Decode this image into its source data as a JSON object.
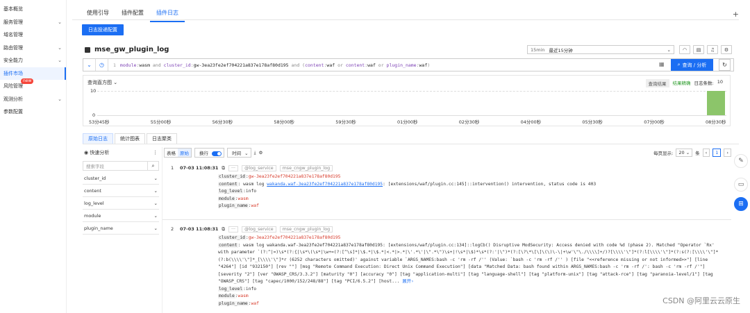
{
  "sidebar": {
    "items": [
      {
        "label": "基本概览",
        "chevron": false
      },
      {
        "label": "服务管理",
        "chevron": true
      },
      {
        "label": "域名管理",
        "chevron": false
      },
      {
        "label": "路由管理",
        "chevron": true
      },
      {
        "label": "安全能力",
        "chevron": true
      },
      {
        "label": "插件市场",
        "chevron": false,
        "active": true
      },
      {
        "label": "风险管理",
        "chevron": false,
        "badge": "new"
      },
      {
        "label": "观测分析",
        "chevron": true
      },
      {
        "label": "参数配置",
        "chevron": false
      }
    ]
  },
  "tabs": [
    {
      "label": "使用引导"
    },
    {
      "label": "插件配置"
    },
    {
      "label": "插件日志",
      "active": true
    }
  ],
  "primary_button": "日志投递配置",
  "logstore": {
    "title": "mse_gw_plugin_log"
  },
  "time": {
    "tag": "15min",
    "label": "最近15分钟"
  },
  "query": {
    "line": "1",
    "parts": [
      {
        "t": "module",
        "c": "k"
      },
      {
        "t": ":",
        "c": "op"
      },
      {
        "t": "wasm",
        "c": "v"
      },
      {
        "t": " and ",
        "c": "op"
      },
      {
        "t": "cluster_id",
        "c": "k"
      },
      {
        "t": ":",
        "c": "op"
      },
      {
        "t": "gw-3ea23fe2ef704221a837e178af80d195",
        "c": "v"
      },
      {
        "t": " and (",
        "c": "op"
      },
      {
        "t": "content",
        "c": "k"
      },
      {
        "t": ":",
        "c": "op"
      },
      {
        "t": "waf",
        "c": "v"
      },
      {
        "t": " or ",
        "c": "op"
      },
      {
        "t": "content",
        "c": "k"
      },
      {
        "t": ":",
        "c": "op"
      },
      {
        "t": "waf",
        "c": "v"
      },
      {
        "t": " or ",
        "c": "op"
      },
      {
        "t": "plugin_name",
        "c": "k"
      },
      {
        "t": ":",
        "c": "op"
      },
      {
        "t": "waf",
        "c": "v"
      },
      {
        "t": ")",
        "c": "op"
      }
    ],
    "button": "查询 / 分析"
  },
  "histogram": {
    "label": "查询直方图",
    "result_tag": "查询结果",
    "accuracy": "结果精确",
    "count_label": "日志条数:",
    "count": "10"
  },
  "chart_data": {
    "type": "bar",
    "title": "查询直方图",
    "categories": [
      "53分45秒",
      "55分00秒",
      "56分30秒",
      "58分00秒",
      "59分30秒",
      "01分00秒",
      "02分30秒",
      "04分00秒",
      "05分30秒",
      "07分00秒",
      "08分30秒"
    ],
    "values": [
      0,
      0,
      0,
      0,
      0,
      0,
      0,
      0,
      0,
      0,
      10
    ],
    "yticks": [
      "10",
      "0"
    ],
    "ylim": [
      0,
      10
    ],
    "bar_color": "#8cc56a"
  },
  "log_tabs": [
    {
      "label": "原始日志",
      "active": true
    },
    {
      "label": "统计图表"
    },
    {
      "label": "日志聚类"
    }
  ],
  "quick": {
    "title": "快速分析",
    "search_placeholder": "搜索字段",
    "fields": [
      "cluster_id",
      "content",
      "log_level",
      "module",
      "plugin_name"
    ]
  },
  "toolbar": {
    "table": "表格",
    "raw": "原始",
    "wrap": "换行",
    "time": "时间",
    "per_page_label": "每页显示:",
    "per_page": "20",
    "unit": "条",
    "page": "1"
  },
  "logs": [
    {
      "index": "1",
      "time": "07-03 11:08:31",
      "source": "@log_service",
      "store": "mse_cngw_plugin_log",
      "fields": {
        "cluster_id": "gw-3ea23fe2ef704221a837e178af80d195",
        "content_prefix": "wasm log ",
        "content_link": "wakanda.waf-3ea23fe2ef704221a837e178af80d195",
        "content_rest": ": [extensions/waf/plugin.cc:145]::intervention() intervention, status code is 403",
        "log_level": "info",
        "module": "wasm",
        "plugin_name": "waf"
      }
    },
    {
      "index": "2",
      "time": "07-03 11:08:31",
      "source": "@log_service",
      "store": "mse_cngw_plugin_log",
      "fields": {
        "cluster_id": "gw-3ea23fe2ef704221a837e178af80d195",
        "content": "wasm log wakanda.waf-3ea23fe2ef704221a837e178af80d195: [extensions/waf/plugin.cc:134]::logCb() Disruptive ModSecurity: Access denied with code %d (phase 2). Matched \"Operator `Rx' with parameter `(?:^|=)\\s*(?:{|\\s*\\(\\s*|\\w+=(?:[^\\s]*|\\$.*|\\$.*|<.*|>.*|\\'.*\\'|\\\".*\\\")\\s+|!\\s*|\\$)*\\s*(?:'|\\\")*(?:[\\?\\*\\[\\]\\(\\)\\-\\|+\\w'\\\"\\./\\\\\\\\]+/)?[\\\\\\\\'\\\"]*(?:l[\\\\\\\\'\\\"]*(?:s(?:[\\\\\\\\'\\\"]*(?:b(\\\\\\\\'\\\"]*_[\\\\\\\\'\\\"]*r (6252 characters omitted)' against variable `ARGS_NAMES:bash -c 'rm -rf /'' (Value: `bash -c 'rm -rf /'' ) [file \"<<reference missing or not informed>>\"] [line \"4264\"] [id \"932150\"] [rev \"\"] [msg \"Remote Command Execution: Direct Unix Command Execution\"] [data \"Matched Data: bash  found within ARGS_NAMES:bash -c 'rm -rf /': bash -c 'rm -rf /'\"] [severity \"2\"] [ver \"OWASP_CRS/3.3.2\"] [maturity \"0\"] [accuracy \"0\"] [tag \"application-multi\"] [tag \"language-shell\"] [tag \"platform-unix\"] [tag \"attack-rce\"] [tag \"paranoia-level/1\"] [tag \"OWASP_CRS\"] [tag \"capec/1000/152/248/88\"] [tag \"PCI/6.5.2\"] [host...",
        "expand": "展开",
        "log_level": "info",
        "module": "wasm",
        "plugin_name": "waf"
      }
    }
  ],
  "watermark": "CSDN @阿里云云原生"
}
